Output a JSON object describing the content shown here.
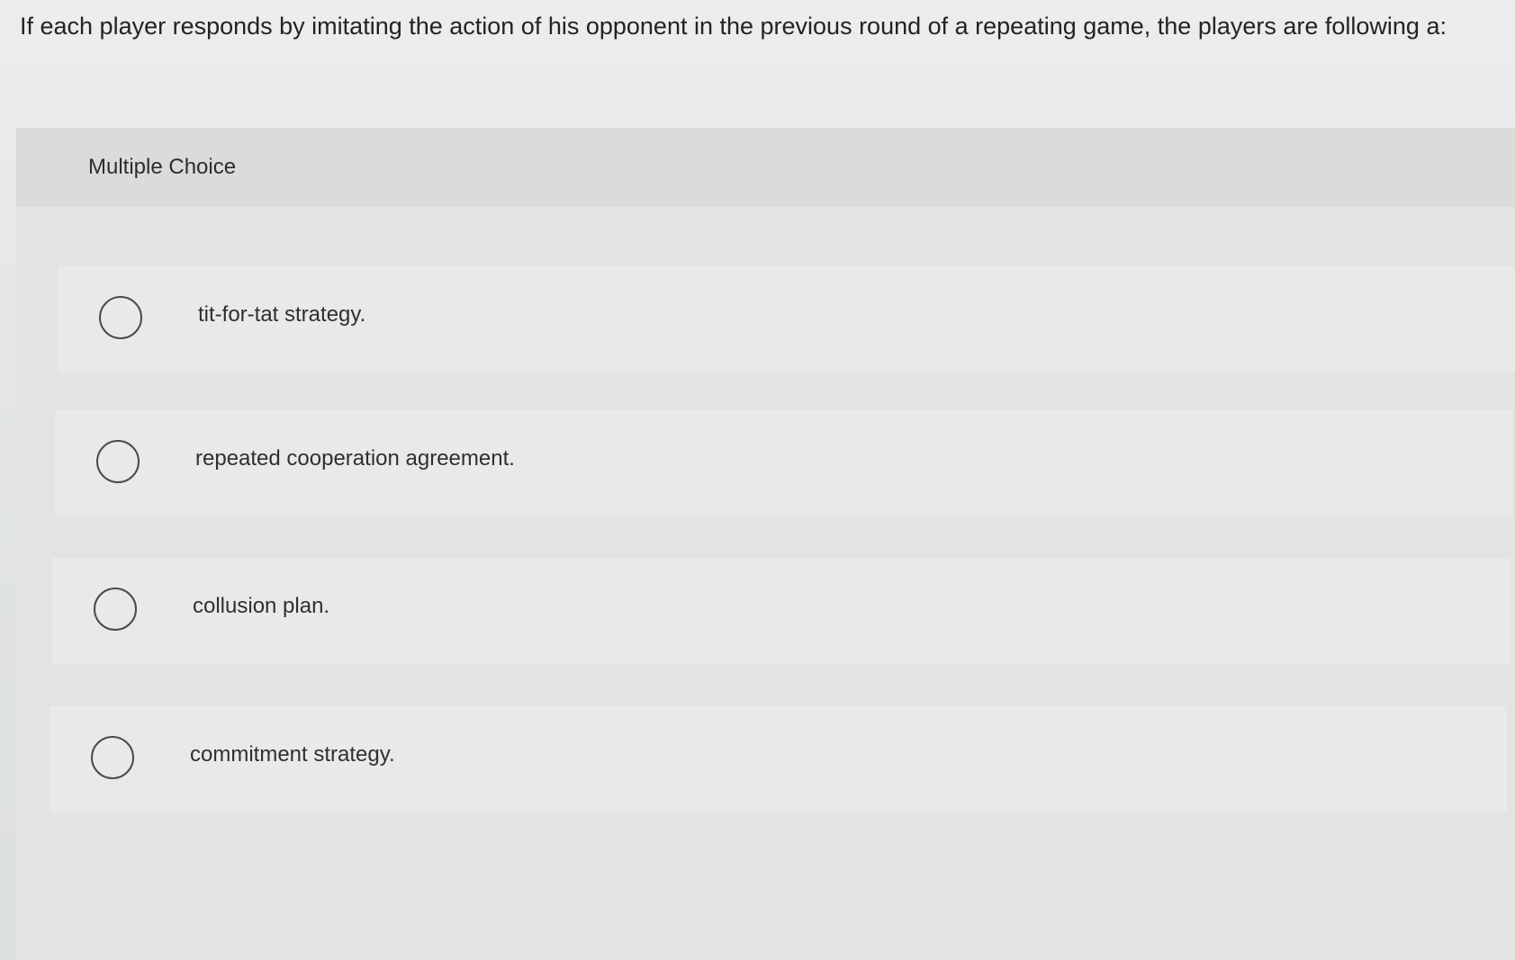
{
  "question": {
    "text": "If each player responds by imitating the action of his opponent in the previous round of a repeating game, the players are following a:"
  },
  "panel": {
    "header": "Multiple Choice"
  },
  "options": [
    {
      "label": "tit-for-tat strategy.",
      "selected": false
    },
    {
      "label": "repeated cooperation agreement.",
      "selected": false
    },
    {
      "label": "collusion plan.",
      "selected": false
    },
    {
      "label": "commitment strategy.",
      "selected": false
    }
  ]
}
